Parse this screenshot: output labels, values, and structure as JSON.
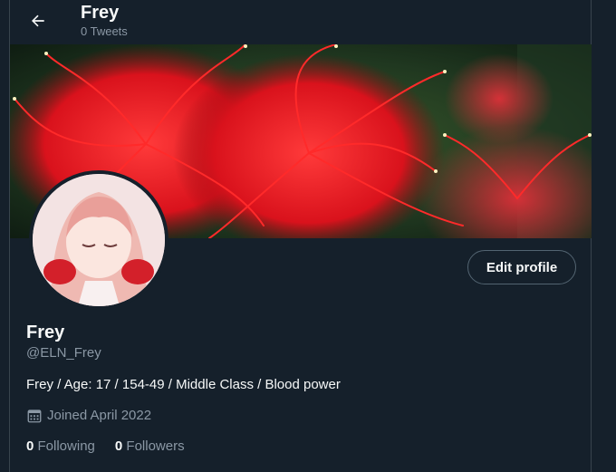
{
  "header": {
    "back_icon": "arrow-left-icon",
    "title": "Frey",
    "tweet_count": "0 Tweets"
  },
  "banner": {
    "description_icon": "red-spider-lily-banner"
  },
  "profile": {
    "display_name": "Frey",
    "handle": "@ELN_Frey",
    "bio": "Frey / Age: 17 / 154-49 / Middle Class / Blood power",
    "joined": "Joined April 2022",
    "edit_button": "Edit profile",
    "calendar_icon": "calendar-icon"
  },
  "stats": [
    {
      "count": "0",
      "label": "Following"
    },
    {
      "count": "0",
      "label": "Followers"
    }
  ],
  "colors": {
    "background": "#15202b",
    "border": "#38444d",
    "muted_text": "#8b98a5",
    "primary_text": "#f7f9f9",
    "banner_red": "#e0202a"
  }
}
